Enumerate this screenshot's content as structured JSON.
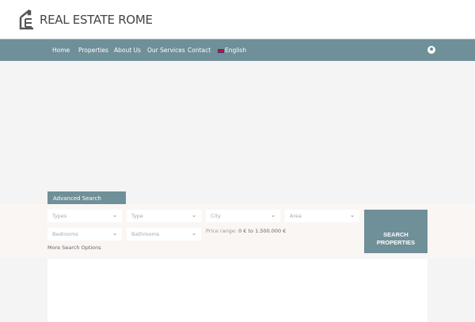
{
  "brand": {
    "name": "REAL ESTATE ROME"
  },
  "nav": {
    "items": [
      "Home",
      "Properties",
      "About Us",
      "Our Services",
      "Contact"
    ],
    "language": "English"
  },
  "search": {
    "tab": "Advanced Search",
    "fields": [
      "Types",
      "Type",
      "City",
      "Area",
      "Bedrooms",
      "Bathrooms"
    ],
    "price_label": "Price range:",
    "price_value": "0 € to 1.500.000 €",
    "more": "More Search Options",
    "button_line1": "SEARCH",
    "button_line2": "PROPERTIES"
  }
}
